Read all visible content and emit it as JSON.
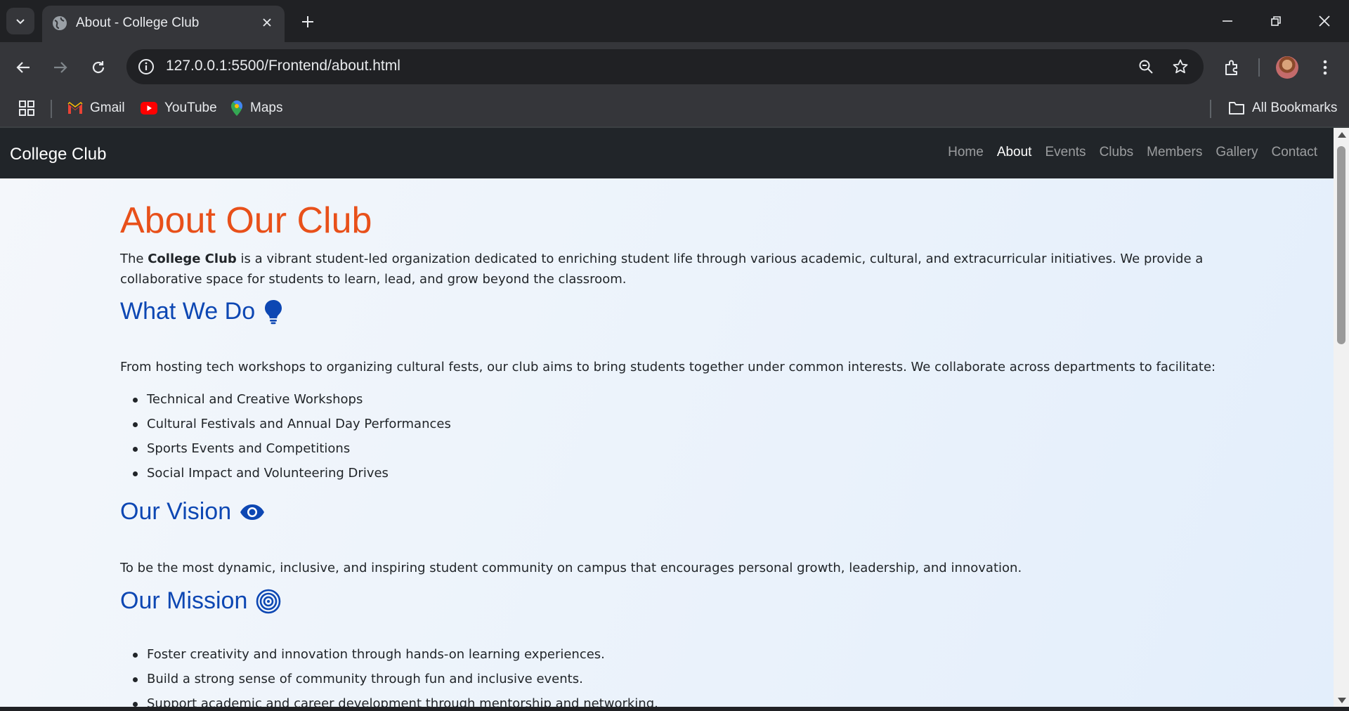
{
  "browser": {
    "tab_title": "About - College Club",
    "url": "127.0.0.1:5500/Frontend/about.html",
    "bookmarks": [
      {
        "label": "Gmail",
        "icon": "gmail-icon"
      },
      {
        "label": "YouTube",
        "icon": "youtube-icon"
      },
      {
        "label": "Maps",
        "icon": "maps-icon"
      }
    ],
    "all_bookmarks_label": "All Bookmarks"
  },
  "site": {
    "brand": "College Club",
    "nav": [
      {
        "label": "Home",
        "active": false
      },
      {
        "label": "About",
        "active": true
      },
      {
        "label": "Events",
        "active": false
      },
      {
        "label": "Clubs",
        "active": false
      },
      {
        "label": "Members",
        "active": false
      },
      {
        "label": "Gallery",
        "active": false
      },
      {
        "label": "Contact",
        "active": false
      }
    ]
  },
  "page": {
    "title": "About Our Club",
    "intro_before": "The ",
    "intro_bold": "College Club",
    "intro_after": " is a vibrant student-led organization dedicated to enriching student life through various academic, cultural, and extracurricular initiatives. We provide a collaborative space for students to learn, lead, and grow beyond the classroom.",
    "what_we_do": {
      "heading": "What We Do",
      "icon": "lightbulb-icon",
      "text": "From hosting tech workshops to organizing cultural fests, our club aims to bring students together under common interests. We collaborate across departments to facilitate:",
      "items": [
        "Technical and Creative Workshops",
        "Cultural Festivals and Annual Day Performances",
        "Sports Events and Competitions",
        "Social Impact and Volunteering Drives"
      ]
    },
    "vision": {
      "heading": "Our Vision",
      "icon": "eye-icon",
      "text": "To be the most dynamic, inclusive, and inspiring student community on campus that encourages personal growth, leadership, and innovation."
    },
    "mission": {
      "heading": "Our Mission",
      "icon": "target-icon",
      "items": [
        "Foster creativity and innovation through hands-on learning experiences.",
        "Build a strong sense of community through fun and inclusive events.",
        "Support academic and career development through mentorship and networking."
      ]
    }
  },
  "colors": {
    "title": "#e8501a",
    "section_heading": "#0d47b3",
    "navbar": "#212529"
  }
}
